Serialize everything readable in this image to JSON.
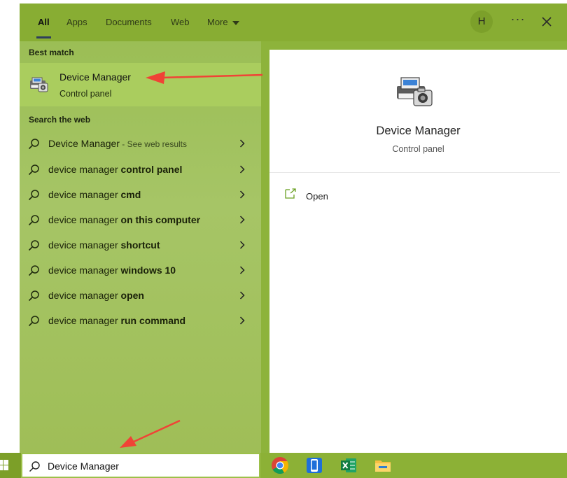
{
  "tabs": [
    {
      "label": "All"
    },
    {
      "label": "Apps"
    },
    {
      "label": "Documents"
    },
    {
      "label": "Web"
    },
    {
      "label": "More"
    }
  ],
  "avatar_initial": "H",
  "ellipsis": "···",
  "best_match": {
    "heading": "Best match",
    "title": "Device Manager",
    "subtitle": "Control panel"
  },
  "web": {
    "heading": "Search the web",
    "first": {
      "base": "Device Manager",
      "sep": " - ",
      "hint": "See web results"
    },
    "items": [
      {
        "base": "device manager ",
        "bold": "control panel"
      },
      {
        "base": "device manager ",
        "bold": "cmd"
      },
      {
        "base": "device manager ",
        "bold": "on this computer"
      },
      {
        "base": "device manager ",
        "bold": "shortcut"
      },
      {
        "base": "device manager ",
        "bold": "windows 10"
      },
      {
        "base": "device manager ",
        "bold": "open"
      },
      {
        "base": "device manager ",
        "bold": "run command"
      }
    ]
  },
  "preview": {
    "title": "Device Manager",
    "subtitle": "Control panel",
    "action_open": "Open"
  },
  "taskbar": {
    "search_value": "Device Manager",
    "apps": [
      "chrome-icon",
      "phone-icon",
      "excel-icon",
      "file-explorer-icon"
    ]
  },
  "colors": {
    "accent_green": "#8db33b",
    "highlight_green": "#aacd5e",
    "annotation_red": "#f04336"
  }
}
